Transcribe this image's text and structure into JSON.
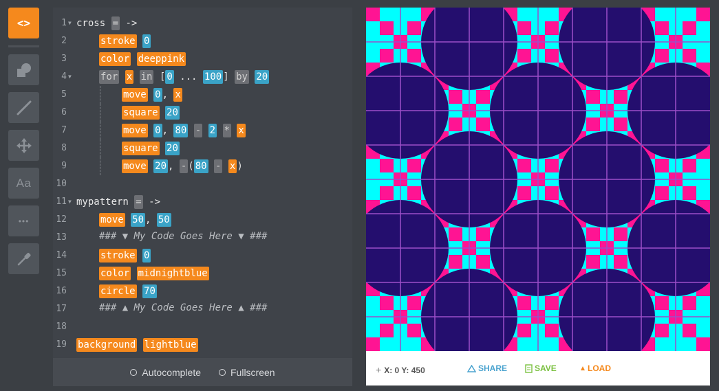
{
  "toolbar": {
    "tools": [
      {
        "name": "code-tool",
        "icon": "code-brackets-icon",
        "label": "<>",
        "active": true
      },
      {
        "name": "shapes-tool",
        "icon": "shapes-icon"
      },
      {
        "name": "line-tool",
        "icon": "line-icon"
      },
      {
        "name": "move-tool",
        "icon": "move-arrows-icon"
      },
      {
        "name": "text-tool",
        "icon": "text-aa-icon",
        "label": "Aa"
      },
      {
        "name": "more-tool",
        "icon": "more-dots-icon",
        "label": "•••"
      },
      {
        "name": "color-picker-tool",
        "icon": "eyedropper-icon"
      }
    ]
  },
  "editor": {
    "lines": [
      {
        "n": "1",
        "fold": true,
        "indent": 0,
        "guides": 0,
        "tokens": [
          [
            "plain",
            "cross "
          ],
          [
            "op",
            "="
          ],
          [
            "plain",
            " ->"
          ]
        ]
      },
      {
        "n": "2",
        "indent": 1,
        "guides": 0,
        "tokens": [
          [
            "kw",
            "stroke"
          ],
          [
            "plain",
            " "
          ],
          [
            "num",
            "0"
          ]
        ]
      },
      {
        "n": "3",
        "indent": 1,
        "guides": 0,
        "tokens": [
          [
            "kw",
            "color"
          ],
          [
            "plain",
            " "
          ],
          [
            "kw",
            "deeppink"
          ]
        ]
      },
      {
        "n": "4",
        "fold": true,
        "indent": 1,
        "guides": 0,
        "tokens": [
          [
            "op",
            "for"
          ],
          [
            "plain",
            " "
          ],
          [
            "kw",
            "x"
          ],
          [
            "plain",
            " "
          ],
          [
            "op",
            "in"
          ],
          [
            "plain",
            " ["
          ],
          [
            "num",
            "0"
          ],
          [
            "plain",
            " ... "
          ],
          [
            "num",
            "100"
          ],
          [
            "plain",
            "] "
          ],
          [
            "op",
            "by"
          ],
          [
            "plain",
            " "
          ],
          [
            "num",
            "20"
          ]
        ]
      },
      {
        "n": "5",
        "indent": 2,
        "guides": 1,
        "tokens": [
          [
            "kw",
            "move"
          ],
          [
            "plain",
            " "
          ],
          [
            "num",
            "0"
          ],
          [
            "plain",
            ", "
          ],
          [
            "kw",
            "x"
          ]
        ]
      },
      {
        "n": "6",
        "indent": 2,
        "guides": 1,
        "tokens": [
          [
            "kw",
            "square"
          ],
          [
            "plain",
            " "
          ],
          [
            "num",
            "20"
          ]
        ]
      },
      {
        "n": "7",
        "indent": 2,
        "guides": 1,
        "tokens": [
          [
            "kw",
            "move"
          ],
          [
            "plain",
            " "
          ],
          [
            "num",
            "0"
          ],
          [
            "plain",
            ", "
          ],
          [
            "num",
            "80"
          ],
          [
            "plain",
            " "
          ],
          [
            "op",
            "-"
          ],
          [
            "plain",
            " "
          ],
          [
            "num",
            "2"
          ],
          [
            "plain",
            " "
          ],
          [
            "op",
            "*"
          ],
          [
            "plain",
            " "
          ],
          [
            "kw",
            "x"
          ]
        ]
      },
      {
        "n": "8",
        "indent": 2,
        "guides": 1,
        "tokens": [
          [
            "kw",
            "square"
          ],
          [
            "plain",
            " "
          ],
          [
            "num",
            "20"
          ]
        ]
      },
      {
        "n": "9",
        "indent": 2,
        "guides": 1,
        "tokens": [
          [
            "kw",
            "move"
          ],
          [
            "plain",
            " "
          ],
          [
            "num",
            "20"
          ],
          [
            "plain",
            ", "
          ],
          [
            "op",
            "-"
          ],
          [
            "plain",
            "("
          ],
          [
            "num",
            "80"
          ],
          [
            "plain",
            " "
          ],
          [
            "op",
            "-"
          ],
          [
            "plain",
            " "
          ],
          [
            "kw",
            "x"
          ],
          [
            "plain",
            ")"
          ]
        ]
      },
      {
        "n": "10",
        "indent": 0,
        "guides": 0,
        "tokens": []
      },
      {
        "n": "11",
        "fold": true,
        "indent": 0,
        "guides": 0,
        "tokens": [
          [
            "plain",
            "mypattern "
          ],
          [
            "op",
            "="
          ],
          [
            "plain",
            " ->"
          ]
        ]
      },
      {
        "n": "12",
        "indent": 1,
        "guides": 0,
        "tokens": [
          [
            "kw",
            "move"
          ],
          [
            "plain",
            " "
          ],
          [
            "num",
            "50"
          ],
          [
            "plain",
            ", "
          ],
          [
            "num",
            "50"
          ]
        ]
      },
      {
        "n": "13",
        "indent": 1,
        "guides": 0,
        "tokens": [
          [
            "cmt",
            "### ▼ My Code Goes Here ▼ ###"
          ]
        ]
      },
      {
        "n": "14",
        "indent": 1,
        "guides": 0,
        "tokens": [
          [
            "kw",
            "stroke"
          ],
          [
            "plain",
            " "
          ],
          [
            "num",
            "0"
          ]
        ]
      },
      {
        "n": "15",
        "indent": 1,
        "guides": 0,
        "tokens": [
          [
            "kw",
            "color"
          ],
          [
            "plain",
            " "
          ],
          [
            "kw",
            "midnightblue"
          ]
        ]
      },
      {
        "n": "16",
        "indent": 1,
        "guides": 0,
        "tokens": [
          [
            "kw",
            "circle"
          ],
          [
            "plain",
            " "
          ],
          [
            "num",
            "70"
          ]
        ]
      },
      {
        "n": "17",
        "indent": 1,
        "guides": 0,
        "tokens": [
          [
            "cmt",
            "### ▲ My Code Goes Here ▲ ###"
          ]
        ]
      },
      {
        "n": "18",
        "indent": 0,
        "guides": 0,
        "tokens": []
      },
      {
        "n": "19",
        "indent": 0,
        "guides": 0,
        "tokens": [
          [
            "kw",
            "background"
          ],
          [
            "plain",
            " "
          ],
          [
            "kw",
            "lightblue"
          ]
        ]
      }
    ]
  },
  "footer": {
    "autocomplete_label": "Autocomplete",
    "fullscreen_label": "Fullscreen"
  },
  "canvas": {
    "colors": {
      "background": "#240e6e",
      "cyan": "#00ffff",
      "pink": "#ff1493",
      "grid": "#9b4fc8"
    },
    "tile_count": 5
  },
  "statusbar": {
    "coordinates": "X: 0 Y: 450",
    "share_label": "SHARE",
    "save_label": "SAVE",
    "load_label": "LOAD"
  }
}
